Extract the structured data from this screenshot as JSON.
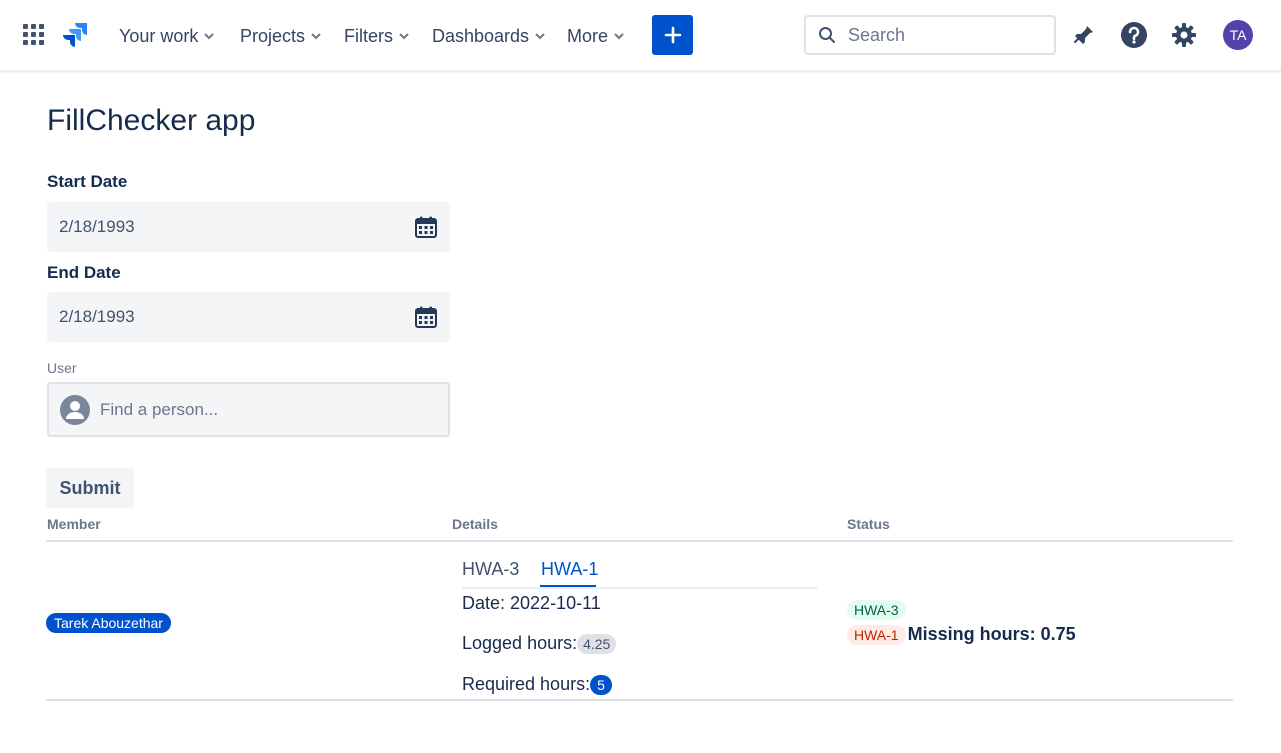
{
  "nav": {
    "items": [
      {
        "label": "Your work"
      },
      {
        "label": "Projects"
      },
      {
        "label": "Filters"
      },
      {
        "label": "Dashboards"
      },
      {
        "label": "More"
      }
    ],
    "search_placeholder": "Search",
    "avatar_initials": "TA",
    "accent_color": "#0052cc"
  },
  "page": {
    "title": "FillChecker app"
  },
  "form": {
    "start_label": "Start Date",
    "start_value": "2/18/1993",
    "end_label": "End Date",
    "end_value": "2/18/1993",
    "user_label": "User",
    "user_placeholder": "Find a person...",
    "submit_label": "Submit"
  },
  "table": {
    "headers": [
      "Member",
      "Details",
      "Status"
    ],
    "rows": [
      {
        "member": "Tarek Abouzethar",
        "tabs": [
          "HWA-3",
          "HWA-1"
        ],
        "active_tab": "HWA-1",
        "date_text": "Date: 2022-10-11",
        "logged_label": "Logged hours:",
        "logged_value": "4.25",
        "required_label": "Required hours:",
        "required_value": "5",
        "status_ok": "HWA-3",
        "status_bad": "HWA-1",
        "missing_text": "Missing hours: 0.75"
      }
    ]
  }
}
